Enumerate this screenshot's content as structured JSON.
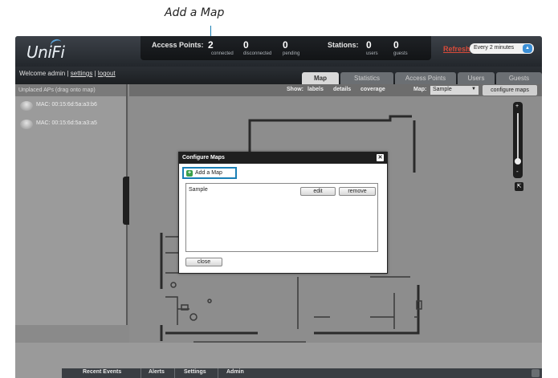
{
  "callout": {
    "label": "Add a Map"
  },
  "header": {
    "logo": "UniFi",
    "access_points_label": "Access Points:",
    "connected_count": "2",
    "connected_label": "connected",
    "disconnected_count": "0",
    "disconnected_label": "disconnected",
    "pending_count": "0",
    "pending_label": "pending",
    "stations_label": "Stations:",
    "users_count": "0",
    "users_label": "users",
    "guests_count": "0",
    "guests_label": "guests",
    "refresh_link": "Refresh",
    "refresh_interval": "Every 2 minutes"
  },
  "welcome": {
    "text": "Welcome admin",
    "settings": "settings",
    "logout": "logout"
  },
  "tabs": [
    "Map",
    "Statistics",
    "Access Points",
    "Users",
    "Guests"
  ],
  "left_panel": {
    "heading": "Unplaced APs (drag onto map)",
    "items": [
      "MAC: 00:15:6d:5a:a3:b6",
      "MAC: 00:15:6d:5a:a3:a5"
    ]
  },
  "map_toolbar": {
    "show_label": "Show:",
    "labels": "labels",
    "details": "details",
    "coverage": "coverage",
    "map_label": "Map:",
    "map_selected": "Sample",
    "configure_maps": "configure maps"
  },
  "zoom": {
    "plus": "+",
    "minus": "-"
  },
  "dialog": {
    "title": "Configure Maps",
    "add_map": "Add a Map",
    "maps": [
      {
        "name": "Sample",
        "edit": "edit",
        "remove": "remove"
      }
    ],
    "close": "close"
  },
  "bottom_tabs": [
    "Recent Events",
    "Alerts",
    "Settings",
    "Admin"
  ],
  "colors": {
    "accent": "#1a7fb5",
    "header": "#23272c",
    "refresh": "#d84b3a",
    "add_icon": "#3aa04a"
  }
}
